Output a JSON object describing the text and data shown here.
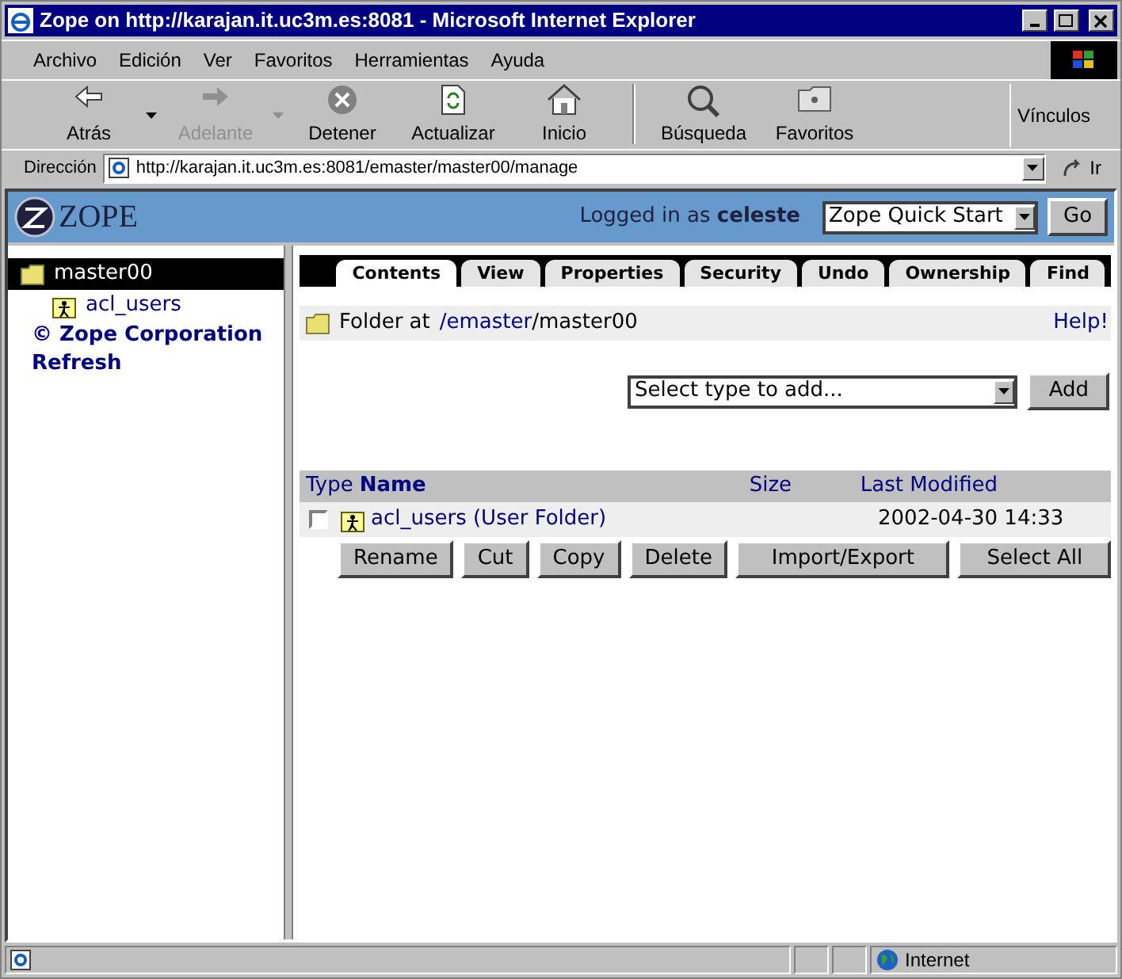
{
  "window": {
    "title": "Zope on http://karajan.it.uc3m.es:8081 - Microsoft Internet Explorer"
  },
  "menu": [
    "Archivo",
    "Edición",
    "Ver",
    "Favoritos",
    "Herramientas",
    "Ayuda"
  ],
  "toolbar": [
    {
      "label": "Atrás",
      "kind": "back",
      "disabled": false,
      "dropdown": true
    },
    {
      "label": "Adelante",
      "kind": "forward",
      "disabled": true,
      "dropdown": true
    },
    {
      "label": "Detener",
      "kind": "stop",
      "disabled": false,
      "dropdown": false
    },
    {
      "label": "Actualizar",
      "kind": "refresh",
      "disabled": false,
      "dropdown": false
    },
    {
      "label": "Inicio",
      "kind": "home",
      "disabled": false,
      "dropdown": false
    },
    {
      "label": "Búsqueda",
      "kind": "search",
      "disabled": false,
      "dropdown": false
    },
    {
      "label": "Favoritos",
      "kind": "favorites",
      "disabled": false,
      "dropdown": false
    }
  ],
  "links_label": "Vínculos",
  "address": {
    "label": "Dirección",
    "value": "http://karajan.it.uc3m.es:8081/emaster/master00/manage",
    "go": "Ir"
  },
  "header": {
    "logo": "ZOPE",
    "logged_in": "Logged in as **celeste**",
    "quick_start": "Zope Quick Start",
    "go": "Go"
  },
  "tree": {
    "label": "master00",
    "selected": true,
    "children": [
      {
        "label": "acl_users",
        "selected": false
      }
    ]
  },
  "tree_links": [
    "© Zope Corporation",
    "Refresh"
  ],
  "tabs": [
    {
      "label": "Contents",
      "selected": true
    },
    {
      "label": "View",
      "selected": false
    },
    {
      "label": "Properties",
      "selected": false
    },
    {
      "label": "Security",
      "selected": false
    },
    {
      "label": "Undo",
      "selected": false
    },
    {
      "label": "Ownership",
      "selected": false
    },
    {
      "label": "Find",
      "selected": false
    }
  ],
  "location": {
    "prefix": "Folder at",
    "link": "/emaster",
    "rest": "/master00",
    "help": "Help!"
  },
  "add": {
    "value": "Select type to add...",
    "button": "Add"
  },
  "table": {
    "columns": [
      {
        "label": "Type",
        "sorted": false
      },
      {
        "label": "Name",
        "sorted": true
      },
      {
        "label": "Size",
        "sorted": false
      },
      {
        "label": "Last Modified",
        "sorted": false
      }
    ],
    "rows": [
      {
        "checked": false,
        "name": "acl_users (User Folder)",
        "modified": "2002-04-30 14:33"
      }
    ]
  },
  "actions": [
    "Rename",
    "Cut",
    "Copy",
    "Delete",
    "Import/Export",
    "Select All"
  ],
  "status": {
    "zone": "Internet"
  }
}
